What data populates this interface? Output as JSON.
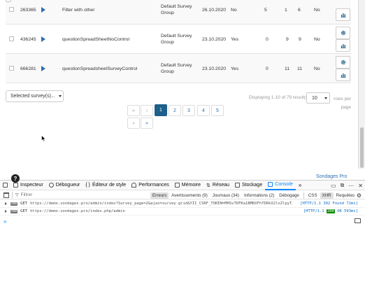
{
  "survey_rows": [
    {
      "id": "263365",
      "title": "Filter with other",
      "group": "Default Survey Group",
      "created": "26.10.2020",
      "active": "No",
      "a": "5",
      "b": "1",
      "c": "6",
      "anon": "No"
    },
    {
      "id": "436245",
      "title": "questionSpreadSheetNoControl",
      "group": "Default Survey Group",
      "created": "23.10.2020",
      "active": "Yes",
      "a": "0",
      "b": "9",
      "c": "9",
      "anon": "No"
    },
    {
      "id": "666281",
      "title": "questionSpreadsheetSurveyControl",
      "group": "Default Survey Group",
      "created": "23.10.2020",
      "active": "Yes",
      "a": "0",
      "b": "11",
      "c": "11",
      "anon": "No"
    }
  ],
  "controls": {
    "selected_surveys": "Selected survey(s)...",
    "summary": "Displaying 1-10 of 79 result(s).",
    "page_size": "10",
    "rows_per_page": "rows per page"
  },
  "pagination": {
    "first": "«",
    "prev": "‹",
    "pages": [
      "1",
      "2",
      "3",
      "4",
      "5"
    ],
    "current": "1",
    "next": "›",
    "last": "»"
  },
  "branding": {
    "help": "?",
    "name": "Sondages Pro"
  },
  "devtools": {
    "tabs": [
      "Inspecteur",
      "Débogueur",
      "Éditeur de style",
      "Performances",
      "Mémoire",
      "Réseau",
      "Stockage",
      "Console"
    ],
    "active_tab": "Console",
    "filter_placeholder": "Filtrer",
    "filters": [
      "Erreurs",
      "Avertissements (9)",
      "Journaux (34)",
      "Informations (2)",
      "Débogage",
      "CSS",
      "XHR",
      "Requêtes"
    ],
    "logs": [
      {
        "badge": "XHR",
        "method": "GET",
        "url": "https://demo.sondages.pro/admin/index?Survey_page=2&ajax=survey-grid&YII_CSRF_TOKEN=MHSvTDFKa1BMRXFhTDRkX2loZlpyT…",
        "proto": "[HTTP/1.1",
        "code": "302",
        "text": "Found 72ms]"
      },
      {
        "badge": "XHR",
        "method": "GET",
        "url": "https://demo.sondages.pro/index.php/admin",
        "proto": "[HTTP/1.1",
        "code": "200",
        "text": "OK 593ms]"
      }
    ],
    "prompt": "»"
  },
  "colors": {
    "accent": "#1e5f8c",
    "link": "#2f6fae",
    "devtools_active": "#0a84ff"
  }
}
